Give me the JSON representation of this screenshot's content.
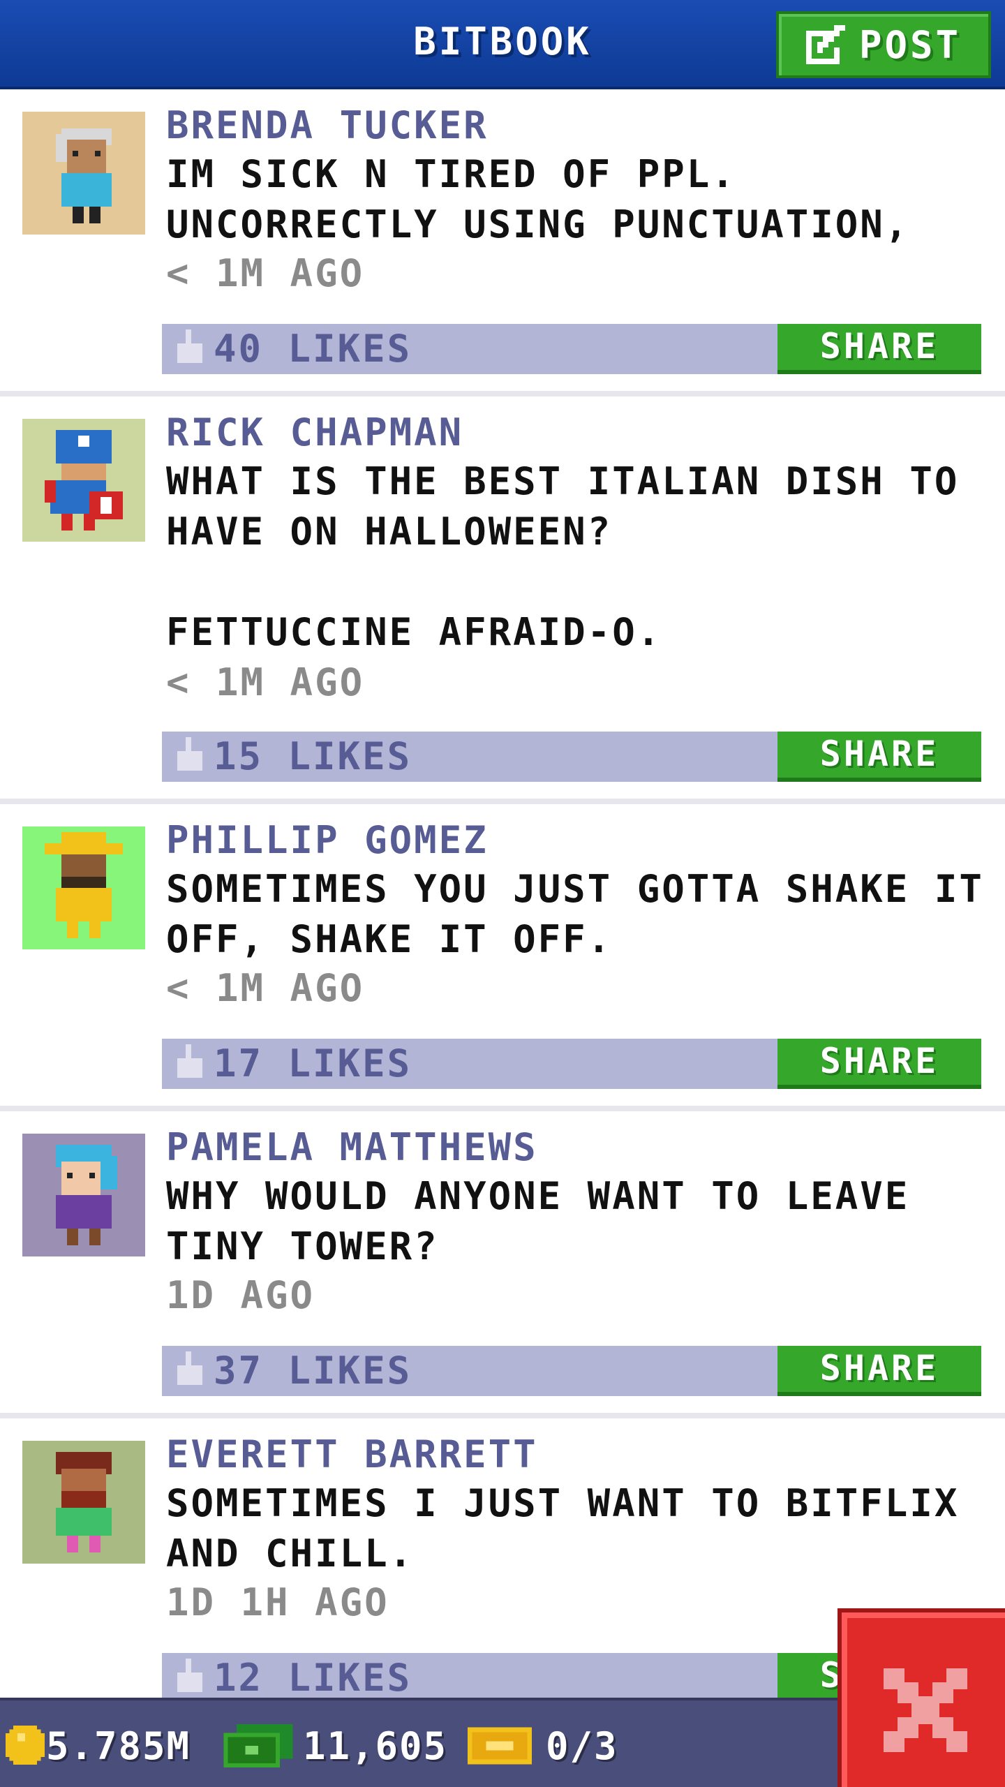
{
  "header": {
    "title": "BITBOOK",
    "post_label": "POST"
  },
  "posts": [
    {
      "author": "BRENDA TUCKER",
      "message": "IM SICK N TIRED OF PPL. UNCORRECTLY USING PUNCTUATION,",
      "time": "< 1M AGO",
      "likes": "40 LIKES",
      "share_label": "SHARE",
      "avatar_bg": "#e5c897"
    },
    {
      "author": "RICK CHAPMAN",
      "message": "WHAT IS THE BEST ITALIAN DISH TO HAVE ON HALLOWEEN?\n\nFETTUCCINE AFRAID-O.",
      "time": "< 1M AGO",
      "likes": "15 LIKES",
      "share_label": "SHARE",
      "avatar_bg": "#cbd79e"
    },
    {
      "author": "PHILLIP GOMEZ",
      "message": "SOMETIMES YOU JUST GOTTA SHAKE IT OFF, SHAKE IT OFF.",
      "time": "< 1M AGO",
      "likes": "17 LIKES",
      "share_label": "SHARE",
      "avatar_bg": "#86f57a"
    },
    {
      "author": "PAMELA MATTHEWS",
      "message": "WHY WOULD ANYONE WANT TO LEAVE TINY TOWER?",
      "time": "1D AGO",
      "likes": "37 LIKES",
      "share_label": "SHARE",
      "avatar_bg": "#9b90b4"
    },
    {
      "author": "EVERETT BARRETT",
      "message": "SOMETIMES I JUST WANT TO BITFLIX AND CHILL.",
      "time": "1D 1H AGO",
      "likes": "12 LIKES",
      "share_label": "SHARE",
      "avatar_bg": "#a9bb82"
    }
  ],
  "footer": {
    "coins": "5.785M",
    "bux": "11,605",
    "tickets": "0/3"
  },
  "icons": {
    "post": "edit-icon",
    "like": "thumbs-up-icon",
    "close": "close-icon",
    "coin": "coin-icon",
    "bux": "bux-icon",
    "ticket": "ticket-icon"
  },
  "colors": {
    "header": "#1a4cb3",
    "accent_green": "#35a82c",
    "like_bar": "#b3b5d6",
    "name": "#585c94",
    "close": "#e02a2a"
  }
}
